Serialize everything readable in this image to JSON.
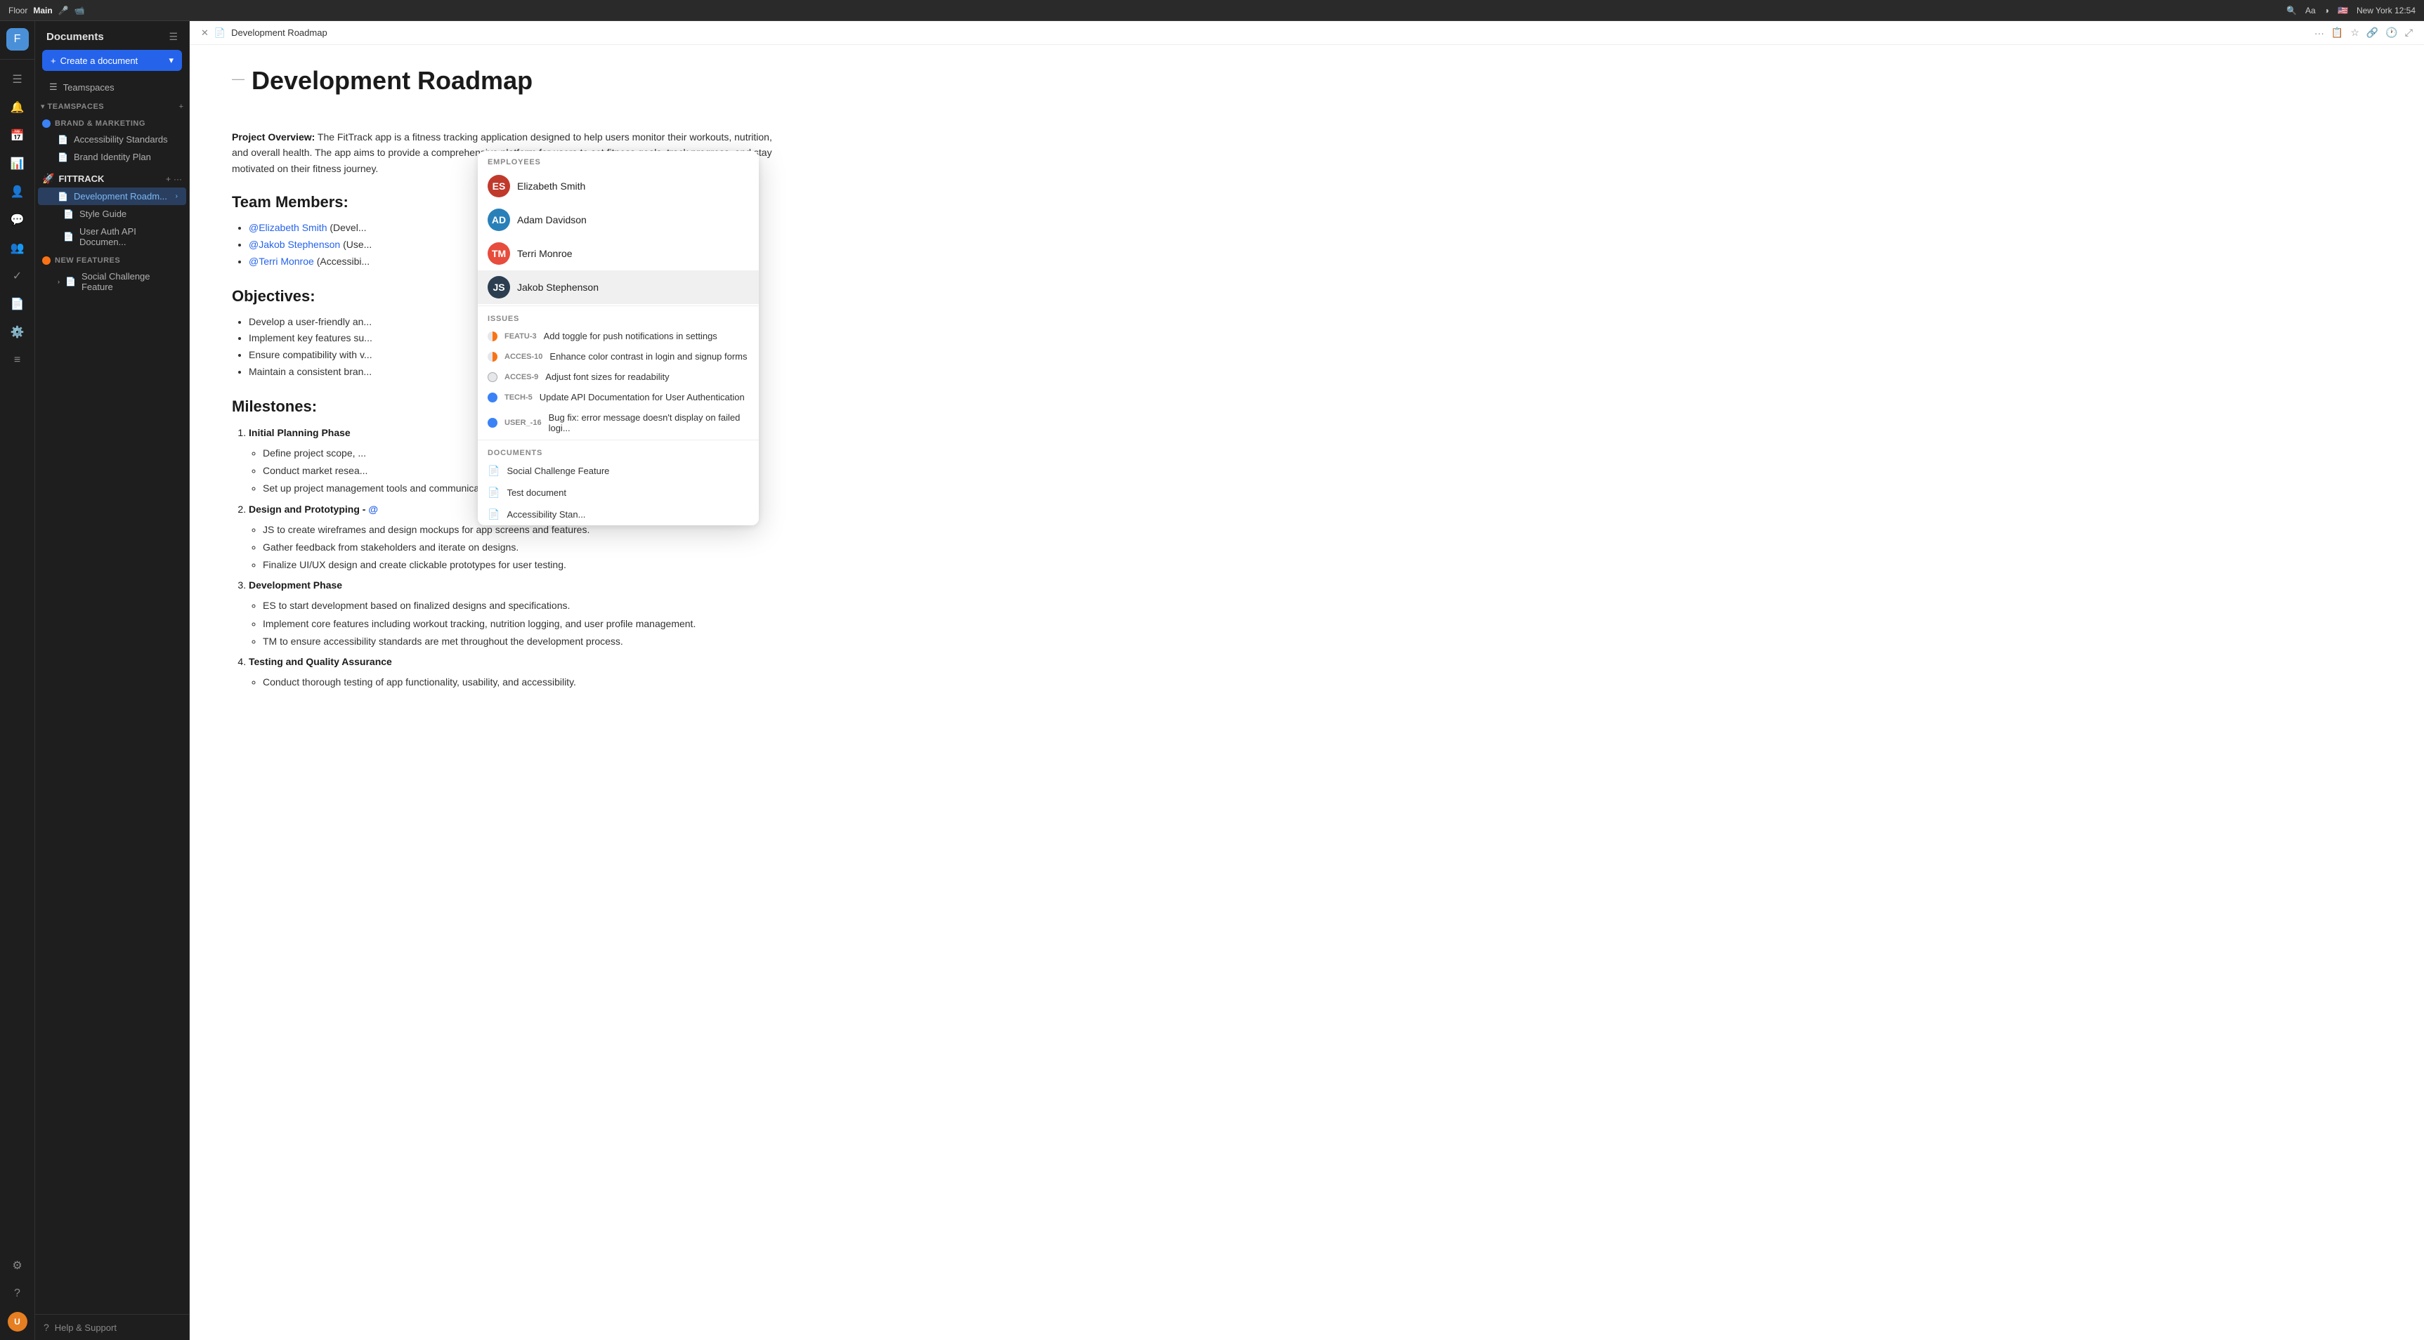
{
  "topbar": {
    "app_name": "Floor",
    "workspace": "Main",
    "location": "New York  12:54"
  },
  "sidebar": {
    "title": "Documents",
    "create_button": "Create a document",
    "teamspaces_label": "Teamspaces",
    "sections": {
      "brand_marketing": {
        "label": "BRAND & MARKETING",
        "items": [
          {
            "id": "accessibility",
            "label": "Accessibility Standards"
          },
          {
            "id": "brand-identity",
            "label": "Brand Identity Plan"
          }
        ]
      },
      "fittrack": {
        "label": "FITTRACK",
        "items": [
          {
            "id": "dev-roadmap",
            "label": "Development Roadm...",
            "active": true
          },
          {
            "id": "style-guide",
            "label": "Style Guide"
          },
          {
            "id": "user-auth",
            "label": "User Auth API Documen..."
          }
        ]
      },
      "new_features": {
        "label": "NEW FEATURES",
        "items": [
          {
            "id": "social-challenge",
            "label": "Social Challenge Feature"
          }
        ]
      }
    },
    "footer": {
      "help_label": "Help & Support"
    }
  },
  "doc_tab": {
    "title": "Development Roadmap"
  },
  "document": {
    "title": "Development Roadmap",
    "overview_label": "Project Overview:",
    "overview_text": "The FitTrack app is a fitness tracking application designed to help users monitor their workouts, nutrition, and overall health. The app aims to provide a comprehensive platform for users to set fitness goals, track progress, and stay motivated on their fitness journey.",
    "team_members_heading": "Team Members:",
    "team": [
      {
        "mention": "@Elizabeth Smith",
        "role": "(Devel..."
      },
      {
        "mention": "@Jakob Stephenson",
        "role": "(Use..."
      },
      {
        "mention": "@Terri Monroe",
        "role": "(Accessibi..."
      }
    ],
    "objectives_heading": "Objectives:",
    "objectives": [
      "Develop a user-friendly an...",
      "Implement key features su...",
      "Ensure compatibility with v...",
      "Maintain a consistent bran..."
    ],
    "milestones_heading": "Milestones:",
    "milestones": [
      {
        "phase": "Initial Planning Phase",
        "tasks": [
          "Define project scope, ...",
          "Conduct market resea...",
          "Set up project management tools and communication channels."
        ]
      },
      {
        "phase": "Design and Prototyping - @",
        "tasks": [
          "JS to create wireframes and design mockups for app screens and features.",
          "Gather feedback from stakeholders and iterate on designs.",
          "Finalize UI/UX design and create clickable prototypes for user testing."
        ]
      },
      {
        "phase": "Development Phase",
        "tasks": [
          "ES to start development based on finalized designs and specifications.",
          "Implement core features including workout tracking, nutrition logging, and user profile management.",
          "TM to ensure accessibility standards are met throughout the development process."
        ]
      },
      {
        "phase": "Testing and Quality Assurance",
        "tasks": [
          "Conduct thorough testing of app functionality, usability, and accessibility."
        ]
      }
    ]
  },
  "popup": {
    "employees_label": "EMPLOYEES",
    "employees": [
      {
        "name": "Elizabeth Smith",
        "color": "#c0392b",
        "initials": "ES"
      },
      {
        "name": "Adam Davidson",
        "color": "#2980b9",
        "initials": "AD"
      },
      {
        "name": "Terri Monroe",
        "color": "#e74c3c",
        "initials": "TM"
      },
      {
        "name": "Jakob Stephenson",
        "color": "#2c3e50",
        "initials": "JS",
        "selected": true
      }
    ],
    "issues_label": "ISSUES",
    "issues": [
      {
        "badge": "FEATU-3",
        "text": "Add toggle for push notifications in settings",
        "type": "orange-half"
      },
      {
        "badge": "ACCES-10",
        "text": "Enhance color contrast in login and signup forms",
        "type": "orange-half"
      },
      {
        "badge": "ACCES-9",
        "text": "Adjust font sizes for readability",
        "type": "gray"
      },
      {
        "badge": "TECH-5",
        "text": "Update API Documentation for User Authentication",
        "type": "blue"
      },
      {
        "badge": "USER_-16",
        "text": "Bug fix: error message doesn't display on failed logi...",
        "type": "blue"
      }
    ],
    "documents_label": "DOCUMENTS",
    "documents": [
      {
        "name": "Social Challenge Feature"
      },
      {
        "name": "Test document"
      },
      {
        "name": "Accessibility Stan..."
      }
    ]
  }
}
